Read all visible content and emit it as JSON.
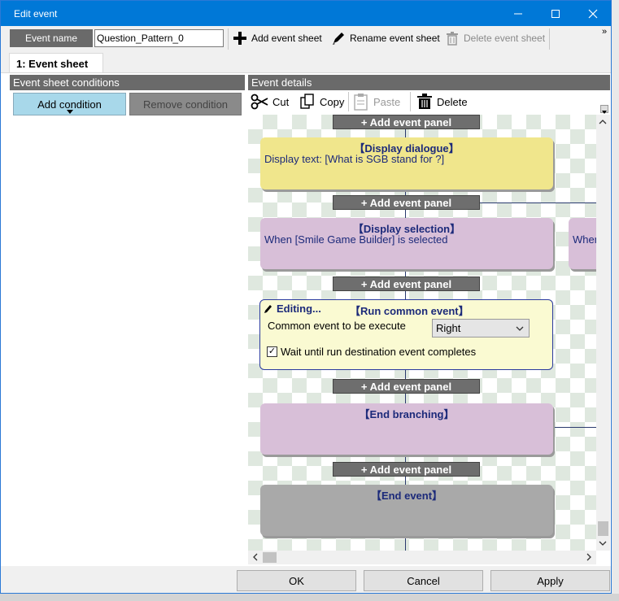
{
  "window": {
    "title": "Edit event"
  },
  "toolbar": {
    "event_name_label": "Event name",
    "event_name_value": "Question_Pattern_0",
    "add_sheet": "Add event sheet",
    "rename_sheet": "Rename event sheet",
    "delete_sheet": "Delete event sheet"
  },
  "tabs": [
    {
      "label": "1: Event sheet"
    }
  ],
  "conditions": {
    "header": "Event sheet conditions",
    "add_button": "Add condition",
    "remove_button": "Remove condition"
  },
  "details": {
    "header": "Event details",
    "cut": "Cut",
    "copy": "Copy",
    "paste": "Paste",
    "delete": "Delete"
  },
  "flow": {
    "add_panel_label": "+ Add event panel",
    "display_dialogue": {
      "title": "【Display dialogue】",
      "text": "Display text: [What is SGB stand for ?]"
    },
    "display_selection": {
      "title": "【Display selection】",
      "text": "When [Smile Game Builder] is selected",
      "text_partial": "When"
    },
    "run_common": {
      "editing": "Editing...",
      "title": "【Run common event】",
      "field_label": "Common event to be execute",
      "selected_value": "Right",
      "checkbox_label": "Wait until run destination event completes",
      "checked": true
    },
    "end_branching": {
      "title": "【End branching】"
    },
    "end_event": {
      "title": "【End event】"
    }
  },
  "footer": {
    "ok": "OK",
    "cancel": "Cancel",
    "apply": "Apply"
  },
  "colors": {
    "titlebar": "#0078d7",
    "dialogue": "#f0e68c",
    "selection": "#d8bfd8",
    "editing": "#fafad2",
    "end": "#a9a9a9"
  }
}
